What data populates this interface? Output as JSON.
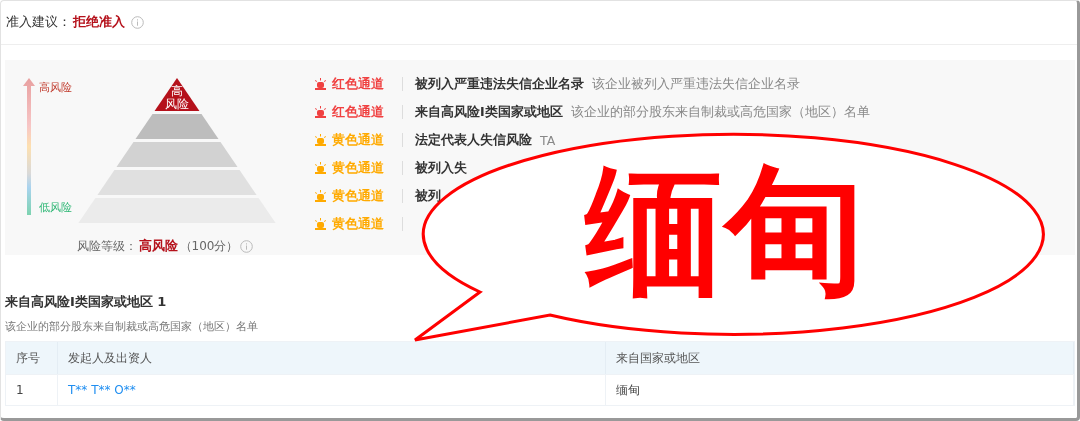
{
  "admission": {
    "label": "准入建议：",
    "value": "拒绝准入"
  },
  "risk_panel": {
    "scale": {
      "high_label": "高风险",
      "low_label": "低风险"
    },
    "pyramid": {
      "tiers": [
        {
          "label_lines": [
            "高",
            "风险"
          ],
          "selected": true
        },
        {
          "selected": false
        },
        {
          "selected": false
        },
        {
          "selected": false
        },
        {
          "selected": false
        }
      ]
    },
    "rating": {
      "label": "风险等级：",
      "value": "高风险",
      "score": "（100分）"
    },
    "channels": [
      {
        "channel": "红色通道",
        "color": "#f04141",
        "title": "被列入严重违法失信企业名录",
        "description": "该企业被列入严重违法失信企业名录"
      },
      {
        "channel": "红色通道",
        "color": "#f04141",
        "title": "来自高风险I类国家或地区",
        "description": "该企业的部分股东来自制裁或高危国家（地区）名单"
      },
      {
        "channel": "黄色通道",
        "color": "#ffaa00",
        "title": "法定代表人失信风险",
        "description": "TA"
      },
      {
        "channel": "黄色通道",
        "color": "#ffaa00",
        "title": "被列入失"
      },
      {
        "channel": "黄色通道",
        "color": "#ffaa00",
        "title": "被列"
      },
      {
        "channel": "黄色通道",
        "color": "#ffaa00"
      }
    ]
  },
  "section": {
    "title": "来自高风险I类国家或地区 1",
    "subtitle": "该企业的部分股东来自制裁或高危国家（地区）名单",
    "table": {
      "columns": [
        "序号",
        "发起人及出资人",
        "来自国家或地区"
      ],
      "rows": [
        {
          "index": "1",
          "person": "T** T** O**",
          "country": "缅甸"
        }
      ]
    }
  },
  "callout": {
    "text": "缅甸"
  }
}
